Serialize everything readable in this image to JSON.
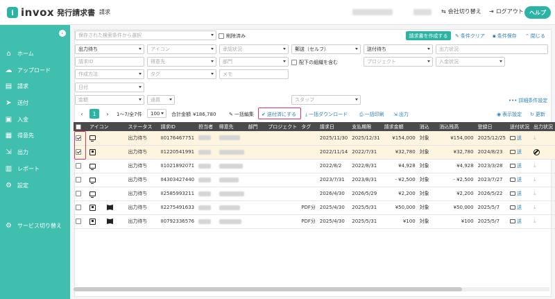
{
  "header": {
    "logo_mark": "i",
    "logo_text": "invox",
    "logo_sub": "発行請求書",
    "nav_main": "請求",
    "switch_company": "会社切り替え",
    "logout": "ログアウト",
    "help": "ヘルプ"
  },
  "sidebar": {
    "items": [
      {
        "label": "ホーム",
        "icon": "home-icon",
        "glyph": "⌂"
      },
      {
        "label": "アップロード",
        "icon": "cloud-upload-icon",
        "glyph": "☁"
      },
      {
        "label": "請求",
        "icon": "document-icon",
        "glyph": "▤"
      },
      {
        "label": "送付",
        "icon": "send-icon",
        "glyph": "➤"
      },
      {
        "label": "入金",
        "icon": "wallet-icon",
        "glyph": "▣"
      },
      {
        "label": "得意先",
        "icon": "building-icon",
        "glyph": "▦"
      },
      {
        "label": "出力",
        "icon": "export-icon",
        "glyph": "⇲"
      },
      {
        "label": "レポート",
        "icon": "chart-icon",
        "glyph": "▥"
      },
      {
        "label": "設定",
        "icon": "gear-icon",
        "glyph": "⚙"
      }
    ],
    "service_switch": "サービス切り替え"
  },
  "filters": {
    "saved_search_placeholder": "保存された検索条件から選択",
    "deleted_label": "削除済み",
    "create_invoice": "請求書を作成する",
    "clear_conditions": "条件クリア",
    "save_conditions": "条件保存",
    "close": "閉じる",
    "row2": [
      "出力待ち",
      "アイコン",
      "承認状況",
      "郵送（セルフ）",
      "送付待ち",
      "出力状況"
    ],
    "row3": [
      "請求ID",
      "得意先",
      "部門",
      "プロジェクト",
      "入金状況"
    ],
    "include_sub": "配下の組織を含む",
    "row4": [
      "作成方法",
      "タグ",
      "メモ"
    ],
    "date": "日付",
    "amount": "金額",
    "currency": "通貨",
    "staff": "スタッフ",
    "advanced": "詳細条件設定"
  },
  "toolbar": {
    "page": "1",
    "range": "1〜7/全7件",
    "per_page": "100",
    "total_label": "合計金額",
    "total": "¥186,780",
    "bulk_edit": "一括編集",
    "mark_sent": "送付済にする",
    "bulk_download": "一括ダウンロード",
    "bulk_print": "一括印刷",
    "export": "出力",
    "display_settings": "表示設定",
    "refresh": "更新"
  },
  "table": {
    "headers": [
      "",
      "アイコン",
      "ステータス",
      "請求ID",
      "担当者",
      "得意先",
      "部門",
      "プロジェクト",
      "タグ",
      "請求日",
      "支払期限",
      "請求金額",
      "消込",
      "消込残高",
      "登録日",
      "送付状況",
      "出力状況"
    ],
    "rows": [
      {
        "checked": true,
        "icons": [
          "pc"
        ],
        "status": "出力待ち",
        "id": "II0176467751",
        "tag": "",
        "date": "2025/11/30",
        "due": "2025/12/31",
        "amount": "¥154,000",
        "recon": "対象",
        "balance": "¥154,000",
        "registered": "2025/12/25",
        "blocked": false,
        "sel": true
      },
      {
        "checked": true,
        "icons": [
          "chip"
        ],
        "status": "出力待ち",
        "id": "II1220541991",
        "tag": "",
        "date": "2022/11/14",
        "due": "2022/7/31",
        "amount": "¥32,780",
        "recon": "対象",
        "balance": "¥32,780",
        "registered": "2024/8/23",
        "blocked": true,
        "sel": true
      },
      {
        "checked": false,
        "icons": [
          "pc"
        ],
        "status": "出力待ち",
        "id": "II1021892071",
        "tag": "",
        "date": "2022/8/2",
        "due": "2022/8/31",
        "amount": "¥4,928",
        "recon": "対象",
        "balance": "¥4,928",
        "registered": "2023/3/28",
        "blocked": false,
        "sel": false
      },
      {
        "checked": false,
        "icons": [
          "pc"
        ],
        "status": "出力待ち",
        "id": "II4303427440",
        "tag": "",
        "date": "2023/7/31",
        "due": "2023/8/31",
        "amount": "- ¥2,500",
        "recon": "対象",
        "balance": "- ¥2,500",
        "registered": "2023/7/27",
        "blocked": false,
        "sel": false
      },
      {
        "checked": false,
        "icons": [
          "pc"
        ],
        "status": "出力待ち",
        "id": "II2585993211",
        "tag": "",
        "date": "2026/4/30",
        "due": "2026/5/29",
        "amount": "¥2,200",
        "recon": "対象",
        "balance": "¥2,200",
        "registered": "2026/5/22",
        "blocked": false,
        "sel": false
      },
      {
        "checked": false,
        "icons": [
          "chip",
          "book"
        ],
        "status": "出力待ち",
        "id": "II2275491633",
        "tag": "PDF分",
        "date": "2025/4/30",
        "due": "2025/5/31",
        "amount": "¥50,000",
        "recon": "対象",
        "balance": "¥50,000",
        "registered": "2025/5/7",
        "blocked": false,
        "sel": false
      },
      {
        "checked": false,
        "icons": [
          "chip",
          "book"
        ],
        "status": "出力待ち",
        "id": "II0792336576",
        "tag": "PDF分",
        "date": "2025/4/30",
        "due": "2025/5/31",
        "amount": "¥100",
        "recon": "対象",
        "balance": "¥100",
        "registered": "2025/5/7",
        "blocked": false,
        "sel": false
      }
    ]
  },
  "colors": {
    "accent": "#2bb3a3",
    "sidebar": "#40bfaf",
    "highlight": "#e0336b",
    "link": "#2a7fc1"
  }
}
